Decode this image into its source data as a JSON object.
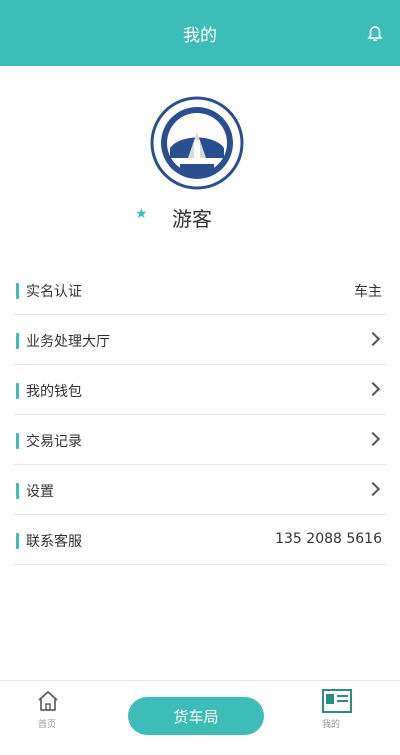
{
  "header": {
    "title": "我的"
  },
  "profile": {
    "user_name": "游客"
  },
  "menu": [
    {
      "label": "实名认证",
      "value": "车主",
      "has_chevron": false
    },
    {
      "label": "业务处理大厅",
      "value": "",
      "has_chevron": true
    },
    {
      "label": "我的钱包",
      "value": "",
      "has_chevron": true
    },
    {
      "label": "交易记录",
      "value": "",
      "has_chevron": true
    },
    {
      "label": "设置",
      "value": "",
      "has_chevron": true
    },
    {
      "label": "联系客服",
      "value": "135 2088 5616",
      "has_chevron": false
    }
  ],
  "bottom_nav": {
    "home_label": "首页",
    "center_button": "货车局",
    "profile_label": "我的"
  },
  "colors": {
    "accent": "#3dbcb8"
  },
  "icons": {
    "bell": "bell-icon",
    "home": "home-icon",
    "profile": "profile-icon",
    "logo": "truck-bureau-logo",
    "star": "star-icon",
    "chevron": "chevron-right-icon"
  }
}
